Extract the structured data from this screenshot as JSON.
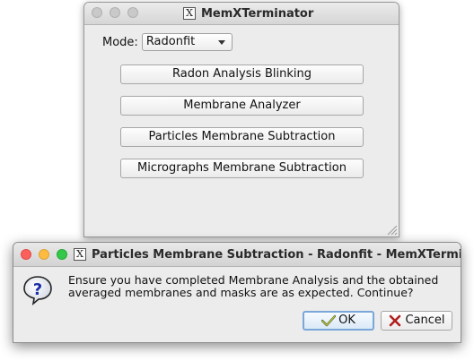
{
  "main_window": {
    "title": "MemXTerminator",
    "mode_label": "Mode:",
    "mode_value": "Radonfit",
    "buttons": [
      "Radon Analysis Blinking",
      "Membrane Analyzer",
      "Particles Membrane Subtraction",
      "Micrographs Membrane Subtraction"
    ]
  },
  "dialog": {
    "title": "Particles Membrane Subtraction - Radonfit - MemXTermi...",
    "message_line1": "Ensure you have completed Membrane Analysis and the obtained",
    "message_line2": "averaged membranes and masks are as expected. Continue?",
    "ok_label": "OK",
    "cancel_label": "Cancel"
  },
  "icons": {
    "x_logo": "x11-logo-icon",
    "question": "question-icon",
    "ok": "check-icon",
    "cancel": "cancel-x-icon"
  },
  "colors": {
    "window_bg": "#ececec",
    "close": "#fc605c",
    "minimize": "#fdbc40",
    "zoom": "#34c84a",
    "ok_border": "#7aa7d9"
  }
}
